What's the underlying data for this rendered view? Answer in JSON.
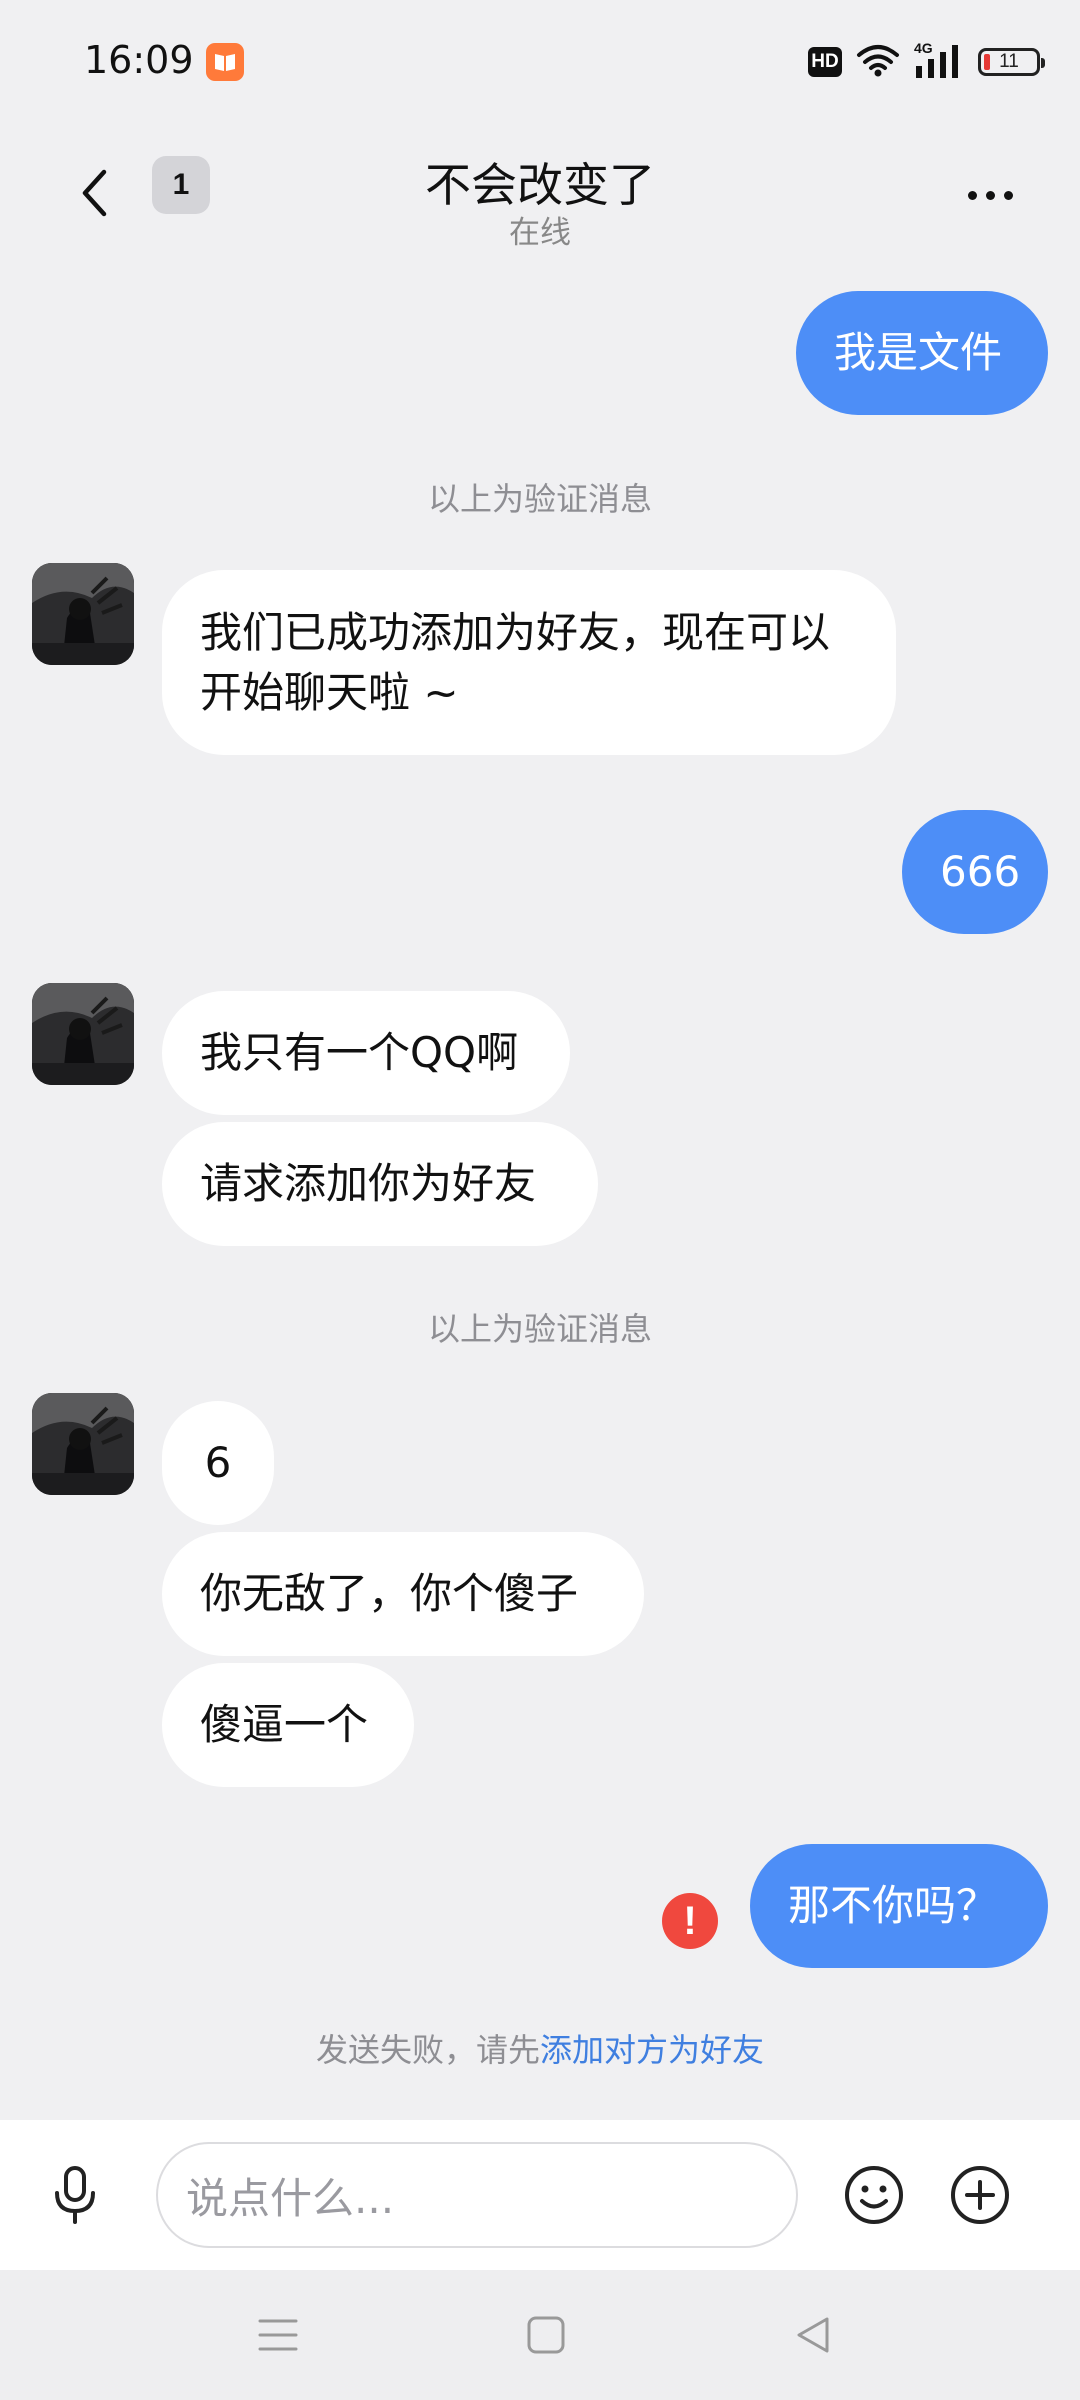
{
  "status_bar": {
    "time": "16:09",
    "hd_label": "HD",
    "network_label": "4G",
    "battery_level": "11",
    "battery_color": "#e53935",
    "app_icon": "book-app-icon"
  },
  "header": {
    "unread_count": "1",
    "title": "不会改变了",
    "subtitle": "在线"
  },
  "messages": [
    {
      "side": "out",
      "text": "我是文件"
    },
    {
      "type": "system",
      "text": "以上为验证消息"
    },
    {
      "side": "in",
      "text": "我们已成功添加为好友，现在可以开始聊天啦 ~"
    },
    {
      "side": "out",
      "text": "666"
    },
    {
      "side": "in",
      "text": "我只有一个QQ啊"
    },
    {
      "side": "in",
      "text": "请求添加你为好友"
    },
    {
      "type": "system",
      "text": "以上为验证消息"
    },
    {
      "side": "in",
      "text": "6"
    },
    {
      "side": "in",
      "text": "你无敌了，你个傻子"
    },
    {
      "side": "in",
      "text": "傻逼一个"
    },
    {
      "side": "out",
      "text": "那不你吗？",
      "status": "failed"
    }
  ],
  "send_failure": {
    "prefix": "发送失败，请先",
    "link": "添加对方为好友"
  },
  "input_bar": {
    "placeholder": "说点什么..."
  },
  "colors": {
    "outgoing_bubble": "#4d8ef7",
    "incoming_bubble": "#ffffff",
    "error": "#f0483e",
    "link": "#3f7fe0"
  }
}
